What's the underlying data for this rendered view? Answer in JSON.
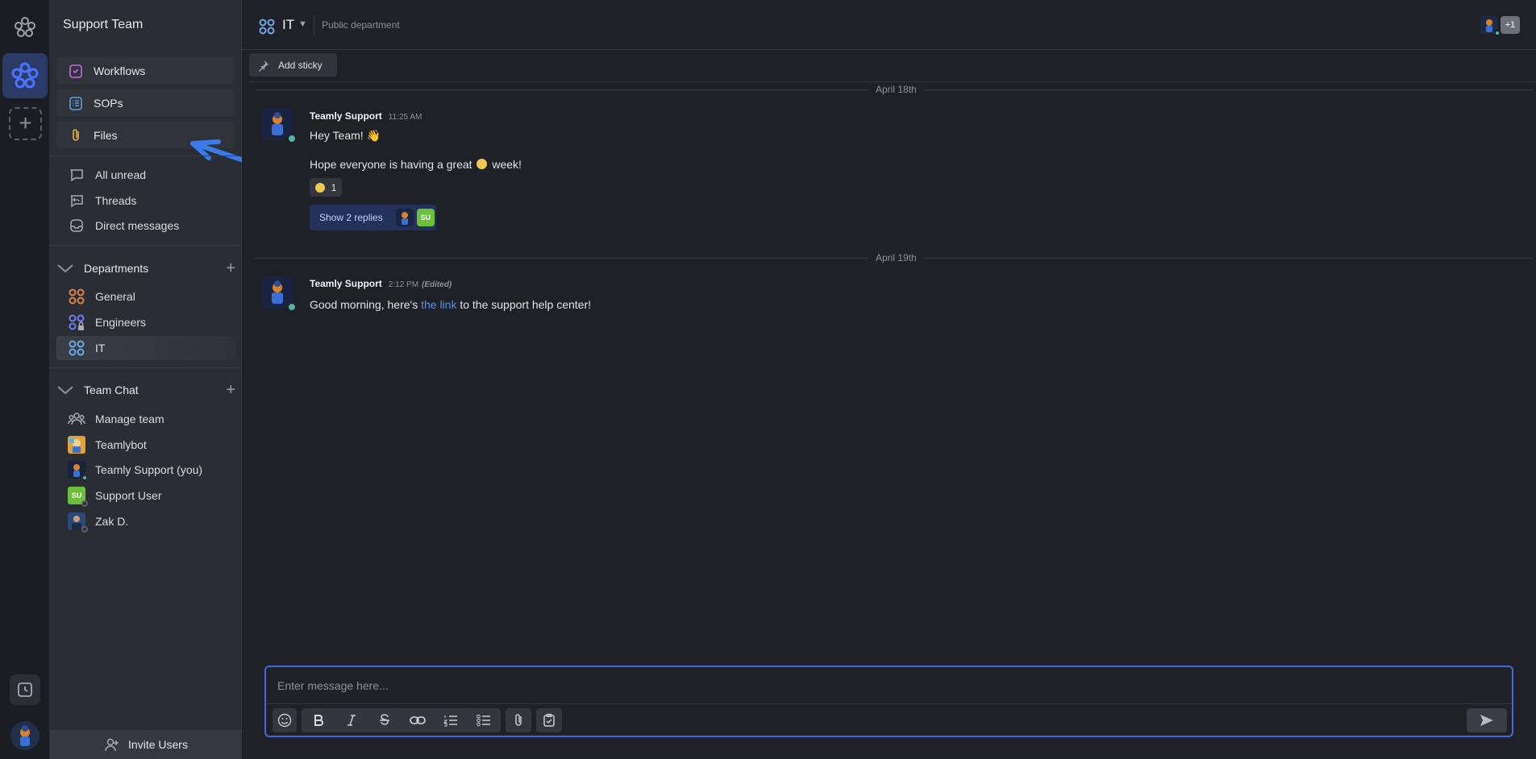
{
  "colors": {
    "accent": "#3d6ae0",
    "link": "#5b8ef0",
    "online": "#4fb6a6",
    "su_green": "#6bbf3a"
  },
  "sidebar": {
    "team_name": "Support Team",
    "top_items": [
      {
        "label": "Workflows",
        "icon": "workflow-icon"
      },
      {
        "label": "SOPs",
        "icon": "sop-list-icon"
      },
      {
        "label": "Files",
        "icon": "paperclip-icon"
      }
    ],
    "nav_items": [
      {
        "label": "All unread",
        "icon": "chat-bubble-icon"
      },
      {
        "label": "Threads",
        "icon": "thread-icon"
      },
      {
        "label": "Direct messages",
        "icon": "inbox-icon"
      }
    ],
    "departments": {
      "heading": "Departments",
      "items": [
        {
          "label": "General",
          "color": "#e0824a"
        },
        {
          "label": "Engineers",
          "color": "#6e7ef0"
        },
        {
          "label": "IT",
          "color": "#6fa8e8"
        }
      ]
    },
    "team_chat": {
      "heading": "Team Chat",
      "items": [
        {
          "label": "Manage team"
        },
        {
          "label": "Teamlybot"
        },
        {
          "label": "Teamly Support (you)"
        },
        {
          "label": "Support User",
          "initials": "SU"
        },
        {
          "label": "Zak D."
        }
      ]
    },
    "invite_label": "Invite Users"
  },
  "header": {
    "channel": "IT",
    "subtitle": "Public department",
    "member_overflow": "+1"
  },
  "toolbar": {
    "add_sticky": "Add sticky"
  },
  "messages": {
    "day1": "April 18th",
    "day2": "April 19th",
    "m1": {
      "author": "Teamly Support",
      "time": "11:25 AM",
      "line1": "Hey Team! 👋",
      "line2_a": "Hope everyone is having a great",
      "line2_b": "week!",
      "reaction_count": "1",
      "replies_label": "Show 2 replies",
      "reply_initials": "SU"
    },
    "m2": {
      "author": "Teamly Support",
      "time": "2:12 PM",
      "edited": "(Edited)",
      "text_a": "Good morning, here's",
      "link": "the link",
      "text_b": "to the support help center!"
    }
  },
  "composer": {
    "placeholder": "Enter message here..."
  }
}
